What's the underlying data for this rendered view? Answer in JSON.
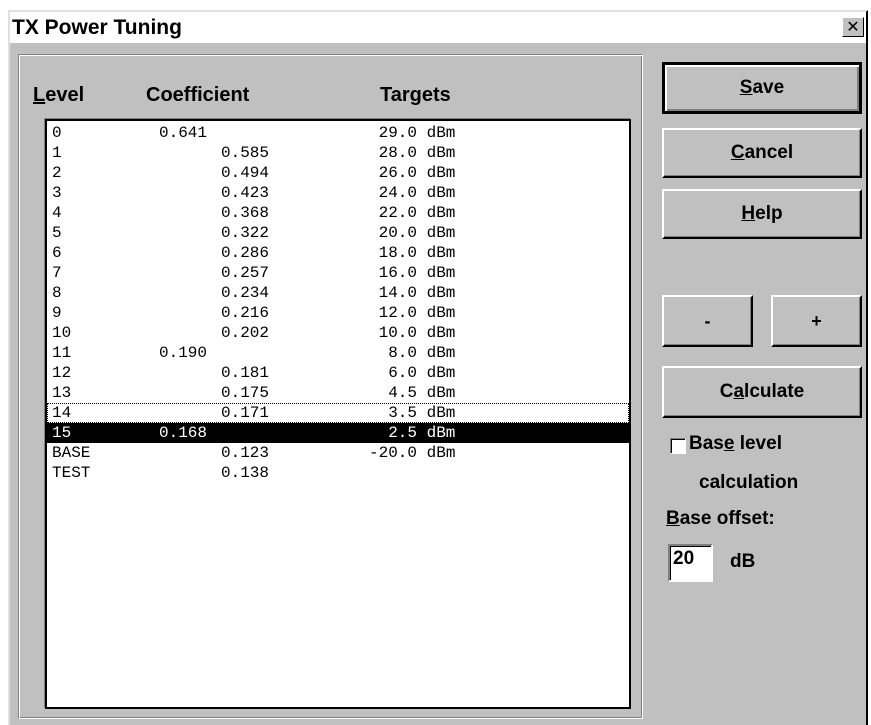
{
  "window": {
    "title": "TX Power Tuning",
    "close_glyph": "✕"
  },
  "columns": {
    "level": {
      "accel": "L",
      "rest": "evel"
    },
    "coefficient": "Coefficient",
    "targets": "Targets"
  },
  "rows": [
    {
      "level": "0",
      "coef": "0.641",
      "target": "29.0 dBm"
    },
    {
      "level": "1",
      "coef": "0.585",
      "target": "28.0 dBm"
    },
    {
      "level": "2",
      "coef": "0.494",
      "target": "26.0 dBm"
    },
    {
      "level": "3",
      "coef": "0.423",
      "target": "24.0 dBm"
    },
    {
      "level": "4",
      "coef": "0.368",
      "target": "22.0 dBm"
    },
    {
      "level": "5",
      "coef": "0.322",
      "target": "20.0 dBm"
    },
    {
      "level": "6",
      "coef": "0.286",
      "target": "18.0 dBm"
    },
    {
      "level": "7",
      "coef": "0.257",
      "target": "16.0 dBm"
    },
    {
      "level": "8",
      "coef": "0.234",
      "target": "14.0 dBm"
    },
    {
      "level": "9",
      "coef": "0.216",
      "target": "12.0 dBm"
    },
    {
      "level": "10",
      "coef": "0.202",
      "target": "10.0 dBm"
    },
    {
      "level": "11",
      "coef": "0.190",
      "target": "8.0 dBm"
    },
    {
      "level": "12",
      "coef": "0.181",
      "target": "6.0 dBm"
    },
    {
      "level": "13",
      "coef": "0.175",
      "target": "4.5 dBm"
    },
    {
      "level": "14",
      "coef": "0.171",
      "target": "3.5 dBm",
      "focused": true
    },
    {
      "level": "15",
      "coef": "0.168",
      "target": "2.5 dBm",
      "selected": true
    },
    {
      "level": "BASE",
      "coef": "0.123",
      "target": "-20.0 dBm"
    },
    {
      "level": "TEST",
      "coef": "0.138",
      "target": ""
    }
  ],
  "buttons": {
    "save": {
      "accel": "S",
      "rest": "ave"
    },
    "cancel": {
      "accel": "C",
      "rest": "ancel"
    },
    "help": {
      "accel": "H",
      "rest": "elp"
    },
    "minus": "-",
    "plus": "+",
    "calculate": {
      "pre": "C",
      "accel": "a",
      "rest": "lculate"
    }
  },
  "base_level_checkbox": {
    "checked": false,
    "label_pre": "Bas",
    "label_accel": "e",
    "label_rest": " level",
    "label_line2": "calculation"
  },
  "base_offset": {
    "label_accel": "B",
    "label_rest": "ase offset:",
    "value": "20",
    "unit": "dB"
  },
  "colors": {
    "face": "#c0c0c0",
    "selection_bg": "#000000",
    "selection_fg": "#ffffff"
  }
}
